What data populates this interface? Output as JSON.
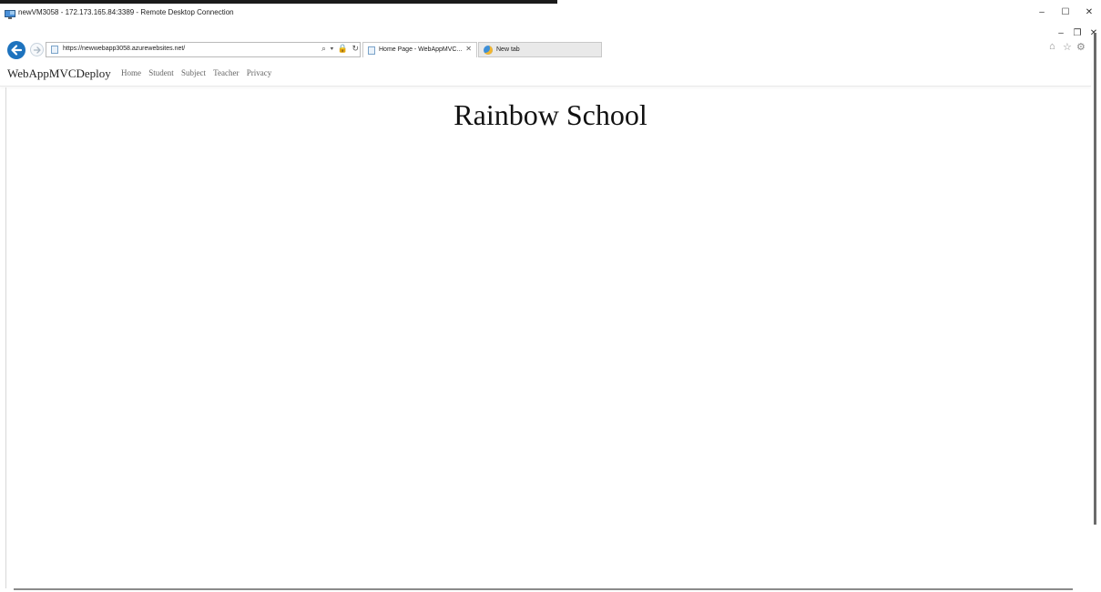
{
  "rdp": {
    "title": "newVM3058 - 172.173.165.84:3389 - Remote Desktop Connection",
    "controls": {
      "minimize": "–",
      "maximize": "☐",
      "close": "✕"
    }
  },
  "ie": {
    "controls": {
      "minimize": "–",
      "restore": "❐",
      "close": "✕"
    },
    "address": {
      "url": "https://newwebapp3058.azurewebsites.net/"
    },
    "address_icons": "⌕ ▾ 🔒 ↻",
    "tabs": [
      {
        "label": "Home Page - WebAppMVC...",
        "close": "✕"
      },
      {
        "label": "New tab"
      }
    ],
    "toolbar": {
      "home": "⌂",
      "favorites": "☆",
      "settings": "⚙"
    }
  },
  "site": {
    "brand": "WebAppMVCDeploy",
    "nav": [
      "Home",
      "Student",
      "Subject",
      "Teacher",
      "Privacy"
    ],
    "heading": "Rainbow School"
  }
}
